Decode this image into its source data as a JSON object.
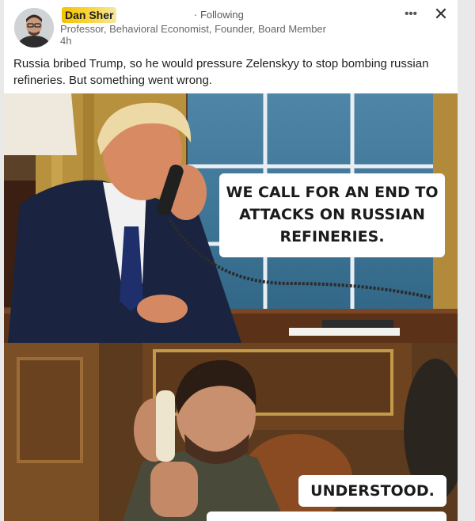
{
  "post": {
    "author_name": "Dan Sher",
    "follow_status": "· Following",
    "author_subtitle": "Professor, Behavioral Economist, Founder, Board Member",
    "timestamp": "4h",
    "more_icon": "•••",
    "close_icon": "✕",
    "text": "Russia bribed Trump, so he would pressure Zelenskyy to stop bombing russian refineries. But something went wrong."
  },
  "meme": {
    "top_caption": "WE CALL FOR AN END TO ATTACKS ON RUSSIAN REFINERIES.",
    "bottom_caption": "UNDERSTOOD."
  },
  "colors": {
    "card_bg": "#ffffff",
    "page_bg": "#e9e9ea",
    "name_highlight": "#f6c200",
    "caption_bg": "#ffffff"
  }
}
